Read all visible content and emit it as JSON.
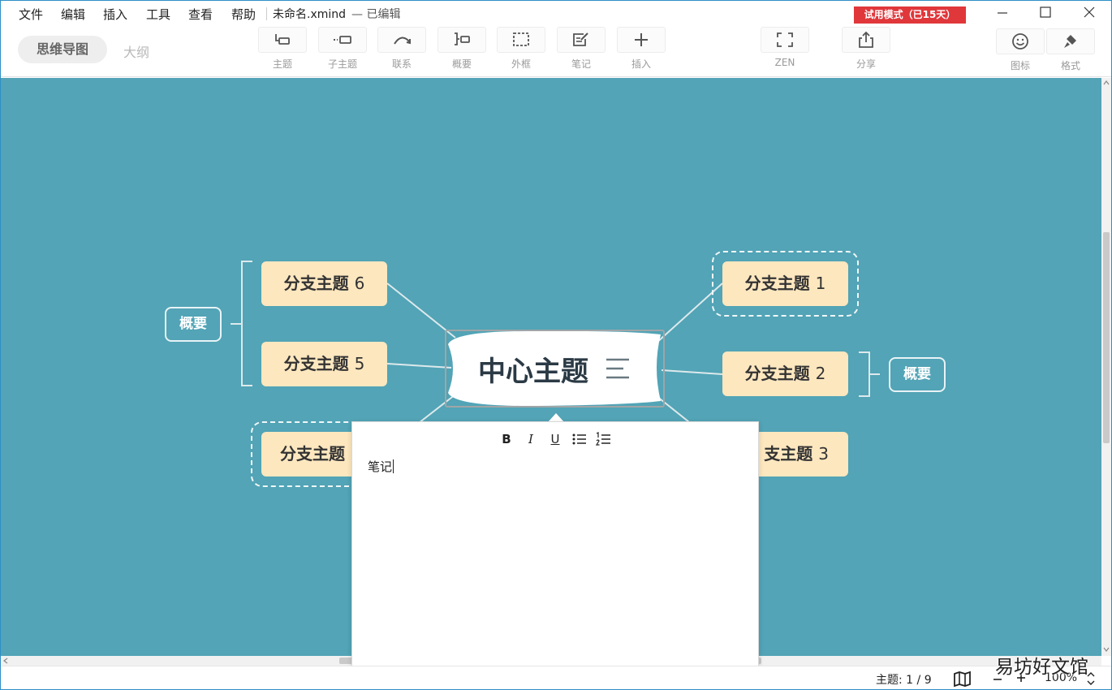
{
  "menu": {
    "items": [
      "文件",
      "编辑",
      "插入",
      "工具",
      "查看",
      "帮助"
    ],
    "document_title": "未命名.xmind",
    "document_status": "— 已编辑",
    "trial_badge": "试用模式（已15天）"
  },
  "toolbar": {
    "view_tabs": [
      "思维导图",
      "大纲"
    ],
    "tools": [
      {
        "label": "主题",
        "icon": "topic-icon"
      },
      {
        "label": "子主题",
        "icon": "subtopic-icon"
      },
      {
        "label": "联系",
        "icon": "relationship-icon"
      },
      {
        "label": "概要",
        "icon": "summary-icon"
      },
      {
        "label": "外框",
        "icon": "boundary-icon"
      },
      {
        "label": "笔记",
        "icon": "note-icon"
      },
      {
        "label": "插入",
        "icon": "plus-icon"
      },
      {
        "label": "ZEN",
        "icon": "fullscreen-icon"
      },
      {
        "label": "分享",
        "icon": "share-icon"
      },
      {
        "label": "图标",
        "icon": "smiley-icon"
      },
      {
        "label": "格式",
        "icon": "brush-icon"
      }
    ]
  },
  "map": {
    "central_topic": "中心主题",
    "branches": [
      {
        "text": "分支主题",
        "num": "1"
      },
      {
        "text": "分支主题",
        "num": "2"
      },
      {
        "text": "支主题",
        "num": "3"
      },
      {
        "text": "分支主题",
        "num": ""
      },
      {
        "text": "分支主题",
        "num": "5"
      },
      {
        "text": "分支主题",
        "num": "6"
      }
    ],
    "summaries": [
      "概要",
      "概要"
    ]
  },
  "note": {
    "format_buttons": [
      "B",
      "I",
      "U"
    ],
    "text": "笔记"
  },
  "status": {
    "topic_count": "主题: 1 / 9",
    "zoom": "100%"
  },
  "watermark": "易坊好文馆",
  "colors": {
    "canvas": "#52a4b6",
    "branch_fill": "#fde7bf",
    "trial_badge": "#e0373b"
  }
}
